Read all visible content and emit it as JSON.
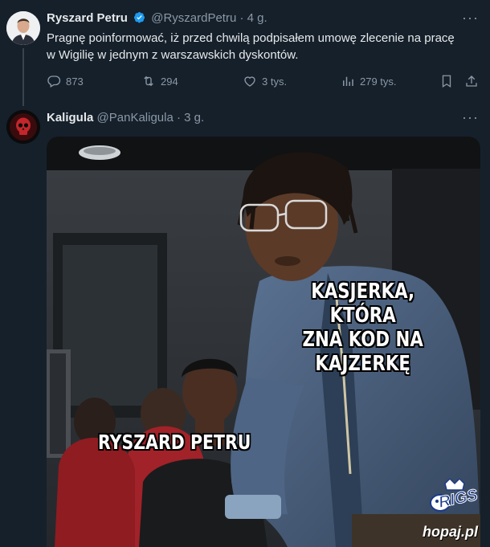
{
  "tweet1": {
    "name": "Ryszard Petru",
    "handle": "@RyszardPetru",
    "time": "· 4 g.",
    "text": "Pragnę poinformować, iż przed chwilą podpisałem umowę zlecenie na pracę w Wigilię w jednym z warszawskich dyskontów.",
    "replies": "873",
    "reposts": "294",
    "likes": "3 tys.",
    "views": "279 tys.",
    "more": "···"
  },
  "tweet2": {
    "name": "Kaligula",
    "handle": "@PanKaligula",
    "time": "· 3 g.",
    "more": "···",
    "meme": {
      "top_caption_line1": "KASJERKA, KTÓRA",
      "top_caption_line2": "ZNA KOD NA KAJZERKĘ",
      "bottom_caption": "RYSZARD PETRU"
    }
  },
  "watermark": {
    "logo_text": "RIGS",
    "site": "hopaj.pl"
  },
  "colors": {
    "background": "#15202b",
    "verified": "#1d9bf0",
    "muted": "#8b98a5",
    "text": "#e7e9ea"
  },
  "icons": [
    "verified-badge-icon",
    "more-icon",
    "reply-icon",
    "repost-icon",
    "like-icon",
    "views-icon",
    "bookmark-icon",
    "share-icon"
  ]
}
